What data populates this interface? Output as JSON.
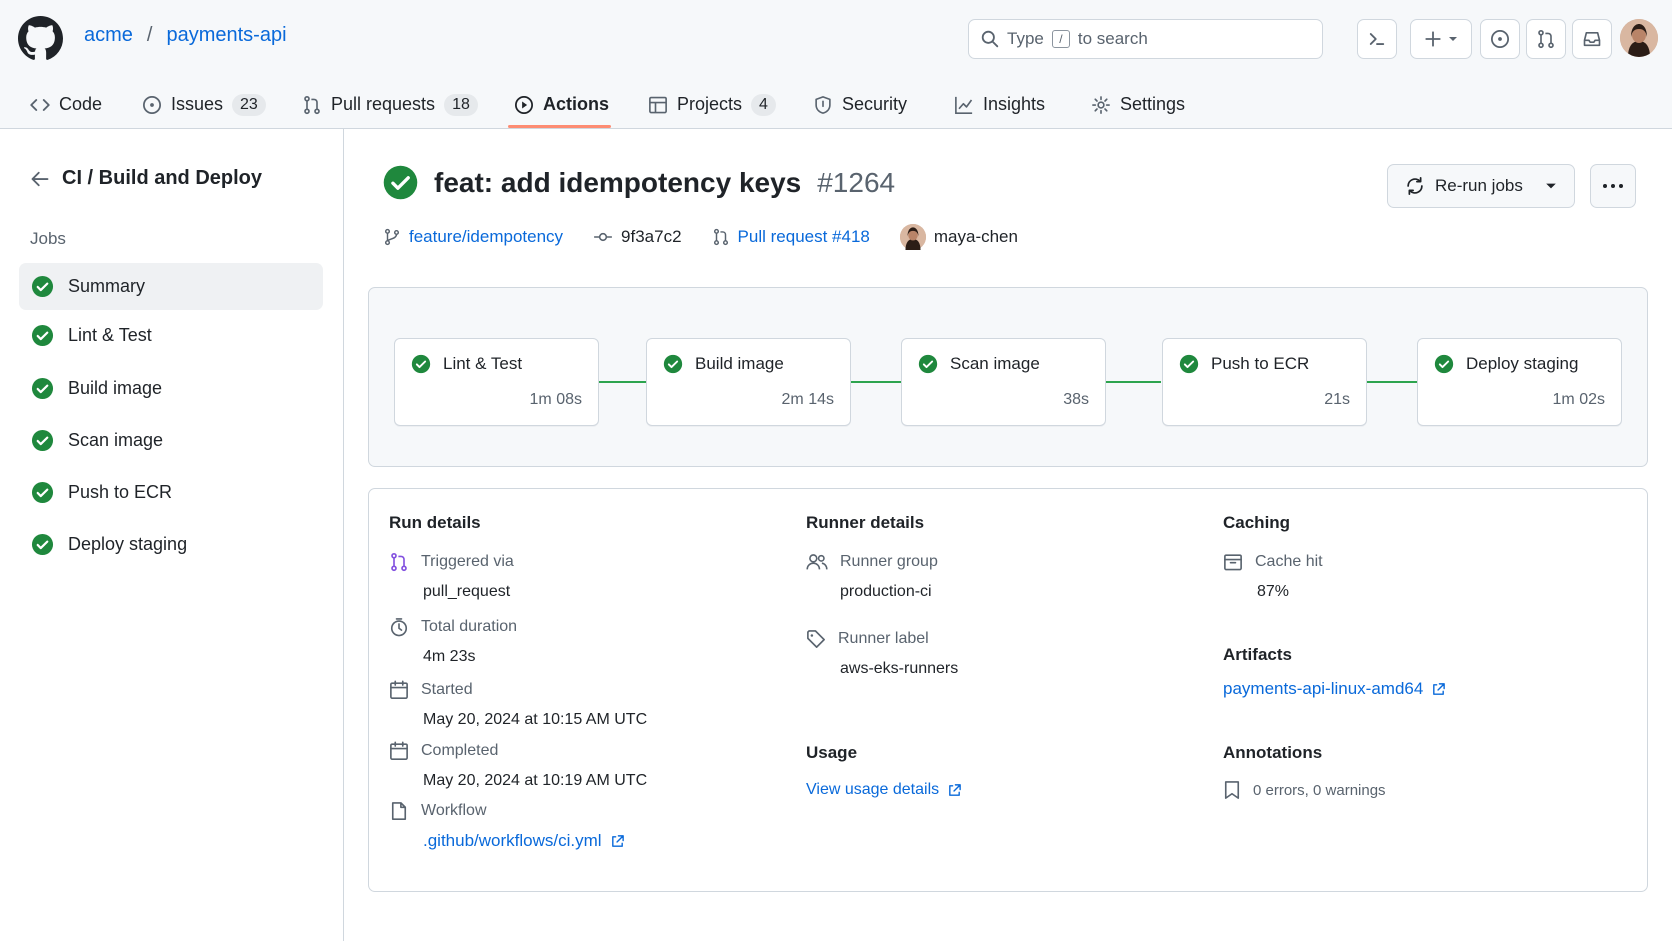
{
  "repo": {
    "owner": "acme",
    "separator": "/",
    "name": "payments-api"
  },
  "search": {
    "prefix": "Type",
    "key": "/",
    "suffix": "to search"
  },
  "tabs": [
    {
      "label": "Code",
      "count": ""
    },
    {
      "label": "Issues",
      "count": "23"
    },
    {
      "label": "Pull requests",
      "count": "18"
    },
    {
      "label": "Actions",
      "count": ""
    },
    {
      "label": "Projects",
      "count": "4"
    },
    {
      "label": "Security",
      "count": ""
    },
    {
      "label": "Insights",
      "count": ""
    },
    {
      "label": "Settings",
      "count": ""
    }
  ],
  "sidebar": {
    "workflow_title": "CI / Build and Deploy",
    "jobs_label": "Jobs",
    "jobs": [
      {
        "label": "Summary"
      },
      {
        "label": "Lint & Test"
      },
      {
        "label": "Build image"
      },
      {
        "label": "Scan image"
      },
      {
        "label": "Push to ECR"
      },
      {
        "label": "Deploy staging"
      }
    ]
  },
  "run": {
    "title": "feat: add idempotency keys",
    "number": "#1264",
    "branch": "feature/idempotency",
    "commit": "9f3a7c2",
    "pull_request": "Pull request #418",
    "author": "maya-chen",
    "rerun_label": "Re-run jobs"
  },
  "graph": {
    "nodes": [
      {
        "name": "Lint & Test",
        "duration": "1m 08s"
      },
      {
        "name": "Build image",
        "duration": "2m 14s"
      },
      {
        "name": "Scan image",
        "duration": "38s"
      },
      {
        "name": "Push to ECR",
        "duration": "21s"
      },
      {
        "name": "Deploy staging",
        "duration": "1m 02s"
      }
    ]
  },
  "details": {
    "run_details": {
      "title": "Run details",
      "triggered_label": "Triggered via",
      "triggered_value": "pull_request",
      "duration_label": "Total duration",
      "duration_value": "4m 23s",
      "started_label": "Started",
      "started_value": "May 20, 2024 at 10:15 AM UTC",
      "completed_label": "Completed",
      "completed_value": "May 20, 2024 at 10:19 AM UTC",
      "workflow_label": "Workflow",
      "workflow_value": ".github/workflows/ci.yml"
    },
    "runner_details": {
      "title": "Runner details",
      "group_label": "Runner group",
      "group_value": "production-ci",
      "label_label": "Runner label",
      "label_value": "aws-eks-runners"
    },
    "usage": {
      "title": "Usage",
      "link": "View usage details"
    },
    "caching": {
      "title": "Caching",
      "cache_label": "Cache hit",
      "cache_value": "87%"
    },
    "artifacts": {
      "title": "Artifacts",
      "link": "payments-api-linux-amd64"
    },
    "annotations": {
      "title": "Annotations",
      "value": "0 errors, 0 warnings"
    }
  },
  "colors": {
    "success": "#1f883d",
    "link": "#0969da",
    "accent_underline": "#fd8c73",
    "trigger_icon": "#8250df"
  }
}
